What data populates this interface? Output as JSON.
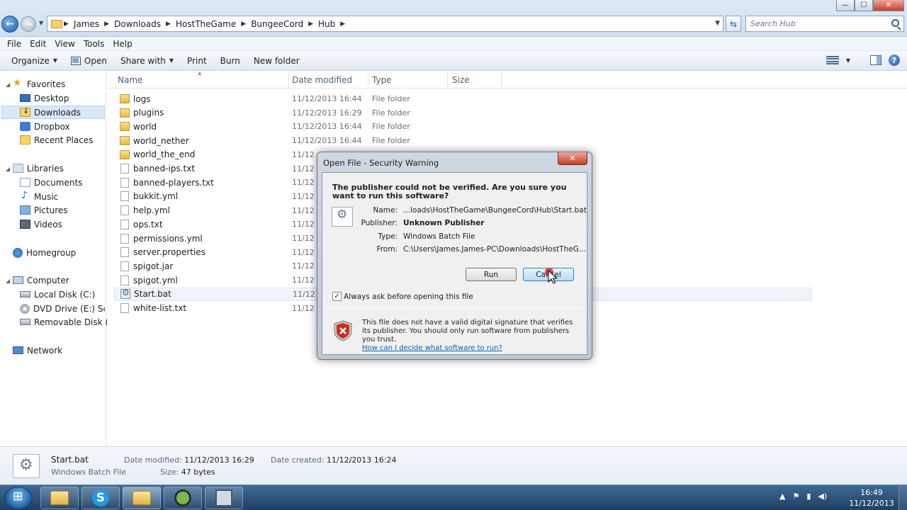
{
  "window": {
    "minimize_glyph": "—",
    "maximize_glyph": "☐",
    "close_glyph": "✕"
  },
  "address": {
    "crumbs": [
      "James",
      "Downloads",
      "HostTheGame",
      "BungeeCord",
      "Hub"
    ],
    "search_placeholder": "Search Hub"
  },
  "menubar": [
    "File",
    "Edit",
    "View",
    "Tools",
    "Help"
  ],
  "commandbar": {
    "organize": "Organize",
    "open": "Open",
    "share_with": "Share with",
    "print": "Print",
    "burn": "Burn",
    "new_folder": "New folder"
  },
  "navpane": {
    "favorites": "Favorites",
    "desktop": "Desktop",
    "downloads": "Downloads",
    "dropbox": "Dropbox",
    "recent_places": "Recent Places",
    "libraries": "Libraries",
    "documents": "Documents",
    "music": "Music",
    "pictures": "Pictures",
    "videos": "Videos",
    "homegroup": "Homegroup",
    "computer": "Computer",
    "local_disk": "Local Disk (C:)",
    "dvd_drive": "DVD Drive (E:) Scribb",
    "removable_disk": "Removable Disk (K:)",
    "network": "Network"
  },
  "columns": {
    "name": "Name",
    "date_modified": "Date modified",
    "type": "Type",
    "size": "Size"
  },
  "files": [
    {
      "name": "logs",
      "date": "11/12/2013 16:44",
      "type": "File folder",
      "icon": "folder-icon"
    },
    {
      "name": "plugins",
      "date": "11/12/2013 16:29",
      "type": "File folder",
      "icon": "folder-icon"
    },
    {
      "name": "world",
      "date": "11/12/2013 16:44",
      "type": "File folder",
      "icon": "folder-icon"
    },
    {
      "name": "world_nether",
      "date": "11/12/2013 16:44",
      "type": "File folder",
      "icon": "folder-icon"
    },
    {
      "name": "world_the_end",
      "date": "11/12",
      "type": "",
      "icon": "folder-icon"
    },
    {
      "name": "banned-ips.txt",
      "date": "11/12",
      "type": "",
      "icon": "text-file-icon"
    },
    {
      "name": "banned-players.txt",
      "date": "11/12",
      "type": "",
      "icon": "text-file-icon"
    },
    {
      "name": "bukkit.yml",
      "date": "11/12",
      "type": "",
      "icon": "yml-file-icon"
    },
    {
      "name": "help.yml",
      "date": "11/12",
      "type": "",
      "icon": "yml-file-icon"
    },
    {
      "name": "ops.txt",
      "date": "11/12",
      "type": "",
      "icon": "text-file-icon"
    },
    {
      "name": "permissions.yml",
      "date": "11/12",
      "type": "",
      "icon": "yml-file-icon"
    },
    {
      "name": "server.properties",
      "date": "11/12",
      "type": "",
      "icon": "file-icon"
    },
    {
      "name": "spigot.jar",
      "date": "11/12",
      "type": "",
      "icon": "jar-file-icon"
    },
    {
      "name": "spigot.yml",
      "date": "11/12",
      "type": "",
      "icon": "yml-file-icon"
    },
    {
      "name": "Start.bat",
      "date": "11/12",
      "type": "",
      "icon": "batch-file-icon"
    },
    {
      "name": "white-list.txt",
      "date": "11/12",
      "type": "",
      "icon": "text-file-icon"
    }
  ],
  "details": {
    "name": "Start.bat",
    "type": "Windows Batch File",
    "date_modified_label": "Date modified:",
    "date_modified": "11/12/2013 16:29",
    "date_created_label": "Date created:",
    "date_created": "11/12/2013 16:24",
    "size_label": "Size:",
    "size": "47 bytes"
  },
  "dialog": {
    "title": "Open File - Security Warning",
    "question": "The publisher could not be verified.  Are you sure you want to run this software?",
    "name_label": "Name:",
    "name_value": "...loads\\HostTheGame\\BungeeCord\\Hub\\Start.bat",
    "publisher_label": "Publisher:",
    "publisher_value": "Unknown Publisher",
    "type_label": "Type:",
    "type_value": "Windows Batch File",
    "from_label": "From:",
    "from_value": "C:\\Users\\James.James-PC\\Downloads\\HostTheG...",
    "run_label": "Run",
    "cancel_label": "Cancel",
    "checkbox_checked": true,
    "checkbox_label": "Always ask before opening this file",
    "warning_text": "This file does not have a valid digital signature that verifies its publisher.  You should only run software from publishers you trust.",
    "help_link": "How can I decide what software to run?"
  },
  "taskbar": {
    "clock_time": "16:49",
    "clock_date": "11/12/2013"
  }
}
